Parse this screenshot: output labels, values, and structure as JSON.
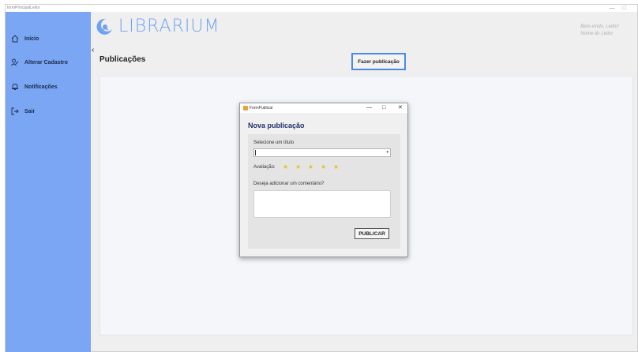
{
  "window": {
    "title": "formPrincipalLeitor",
    "controls": [
      "—",
      "□"
    ]
  },
  "sidebar": {
    "items": [
      {
        "label": "Início",
        "icon": "home-icon"
      },
      {
        "label": "Alterar Cadastro",
        "icon": "user-edit-icon"
      },
      {
        "label": "Notificações",
        "icon": "bell-icon"
      },
      {
        "label": "Sair",
        "icon": "logout-icon"
      }
    ]
  },
  "header": {
    "logo_text": "LIBRARIUM",
    "welcome_line1": "Bem-vindo, Leitor!",
    "welcome_line2": "Nome do Leitor",
    "back_symbol": "‹"
  },
  "page": {
    "title": "Publicações",
    "post_button": "Fazer publicação"
  },
  "dialog": {
    "window_title": "FormPublicar",
    "min_symbol": "—",
    "max_symbol": "□",
    "close_symbol": "✕",
    "heading": "Nova publicação",
    "title_label": "Selecione um título",
    "rating_label": "Avaliação:",
    "stars": [
      "★",
      "★",
      "★",
      "★",
      "★"
    ],
    "comment_label": "Deseja adicionar um comentário?",
    "publish_button": "PUBLICAR",
    "dropdown_arrow": "▾"
  },
  "colors": {
    "sidebar": "#7aa6f3",
    "accent": "#4a8ae6",
    "star": "#e9c21b",
    "heading": "#1f2f6b"
  }
}
